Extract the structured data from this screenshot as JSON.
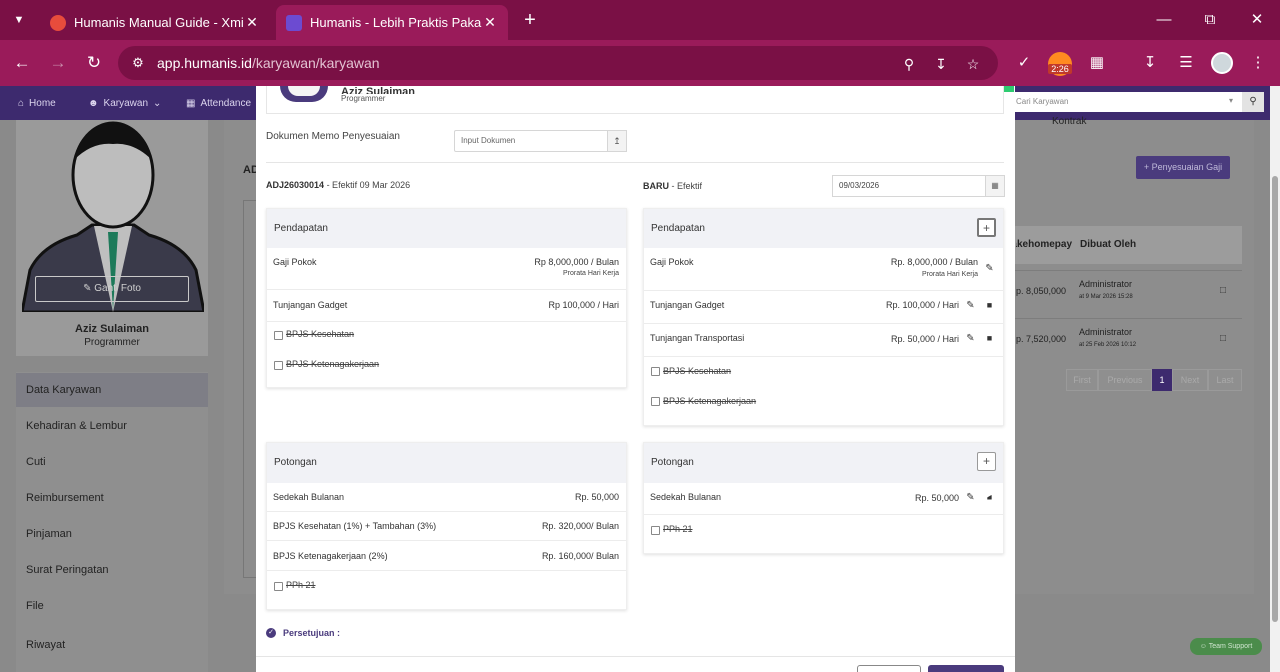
{
  "browser": {
    "tabs": [
      {
        "title": "Humanis Manual Guide - Xmind",
        "active": false,
        "favicon_color": "#e74c3c"
      },
      {
        "title": "Humanis - Lebih Praktis Pakai HR",
        "active": true,
        "favicon_color": "#6c4bd1"
      }
    ],
    "url_host": "app.humanis.id",
    "url_path": "/karyawan/karyawan",
    "extension_badge": "2:26",
    "icons": {
      "tab_menu": "chevron-down-icon",
      "new_tab": "plus-icon",
      "minimize": "minimize-icon",
      "restore": "restore-icon",
      "close": "close-icon",
      "back": "back-arrow-icon",
      "forward": "forward-arrow-icon",
      "reload": "reload-icon",
      "site_settings": "tune-icon",
      "zoom": "zoom-icon",
      "install": "install-icon",
      "bookmark": "star-icon",
      "extensions": "puzzle-icon",
      "downloads": "download-icon",
      "media": "media-icon",
      "menu": "more-vertical-icon"
    },
    "chrome_colors": {
      "tabbar": "#7a1045",
      "toolbar": "#9a1b5a"
    }
  },
  "app_nav": {
    "items": [
      {
        "label": "Home",
        "icon": "home-icon"
      },
      {
        "label": "Karyawan",
        "icon": "users-icon"
      },
      {
        "label": "Attendance",
        "icon": "calendar-icon"
      }
    ]
  },
  "left": {
    "ganti_foto": "Ganti Foto",
    "name": "Aziz Sulaiman",
    "role": "Programmer",
    "menu": [
      {
        "label": "Data Karyawan",
        "active": true
      },
      {
        "label": "Kehadiran & Lembur",
        "active": false
      },
      {
        "label": "Cuti",
        "active": false
      },
      {
        "label": "Reimbursement",
        "active": false
      },
      {
        "label": "Pinjaman",
        "active": false
      },
      {
        "label": "Surat Peringatan",
        "active": false
      },
      {
        "label": "File",
        "active": false
      },
      {
        "label": "Riwayat",
        "active": false
      }
    ]
  },
  "right_bg": {
    "search_placeholder": "Cari Karyawan",
    "kontrak": "Kontrak",
    "penyesuaian_button": "Penyesuaian Gaji",
    "adj_fragment": "AD",
    "table_headers": [
      "Takehomepay",
      "Dibuat Oleh"
    ],
    "rows": [
      {
        "takehome": "Rp. 8,050,000",
        "by": "Administrator",
        "at": "at 9 Mar 2026 15:28"
      },
      {
        "takehome": "Rp. 7,520,000",
        "by": "Administrator",
        "at": "at 25 Feb 2026 10:12"
      }
    ],
    "pager": [
      "First",
      "Previous",
      "1",
      "Next",
      "Last"
    ],
    "team_support": "Team Support"
  },
  "modal": {
    "employee_name": "Aziz Sulaiman",
    "employee_role": "Programmer",
    "memo_label": "Dokumen Memo Penyesuaian",
    "memo_placeholder": "Input Dokumen",
    "adj_code": "ADJ26030014",
    "adj_effective": " - Efektif 09 Mar 2026",
    "baru_label": "BARU",
    "baru_effective": " - Efektif",
    "baru_date": "09/03/2026",
    "old": {
      "pendapatan_title": "Pendapatan",
      "pendapatan_rows": [
        {
          "label": "Gaji Pokok",
          "value": "Rp 8,000,000 / Bulan",
          "sub": "Prorata Hari Kerja"
        },
        {
          "label": "Tunjangan Gadget",
          "value": "Rp 100,000 / Hari"
        }
      ],
      "pendapatan_checks": [
        "BPJS Kesehatan",
        "BPJS Ketenagakerjaan"
      ],
      "potongan_title": "Potongan",
      "potongan_rows": [
        {
          "label": "Sedekah Bulanan",
          "value": "Rp. 50,000"
        },
        {
          "label": "BPJS Kesehatan (1%) + Tambahan (3%)",
          "value": "Rp. 320,000/ Bulan"
        },
        {
          "label": "BPJS Ketenagakerjaan (2%)",
          "value": "Rp. 160,000/ Bulan"
        }
      ],
      "potongan_checks": [
        "PPh 21"
      ]
    },
    "new": {
      "pendapatan_title": "Pendapatan",
      "pendapatan_rows": [
        {
          "label": "Gaji Pokok",
          "value": "Rp. 8,000,000 / Bulan",
          "sub": "Prorata Hari Kerja"
        },
        {
          "label": "Tunjangan Gadget",
          "value": "Rp. 100,000 / Hari"
        },
        {
          "label": "Tunjangan Transportasi",
          "value": "Rp. 50,000 / Hari"
        }
      ],
      "pendapatan_checks": [
        "BPJS Kesehatan",
        "BPJS Ketenagakerjaan"
      ],
      "potongan_title": "Potongan",
      "potongan_rows": [
        {
          "label": "Sedekah Bulanan",
          "value": "Rp. 50,000"
        }
      ],
      "potongan_checks": [
        "PPh 21"
      ],
      "add_symbol": "+"
    },
    "persetujuan": "Persetujuan :"
  },
  "colors": {
    "brand": "#4a3b7d",
    "overlay": "#8a8a8a",
    "support": "#4b8c4b"
  }
}
